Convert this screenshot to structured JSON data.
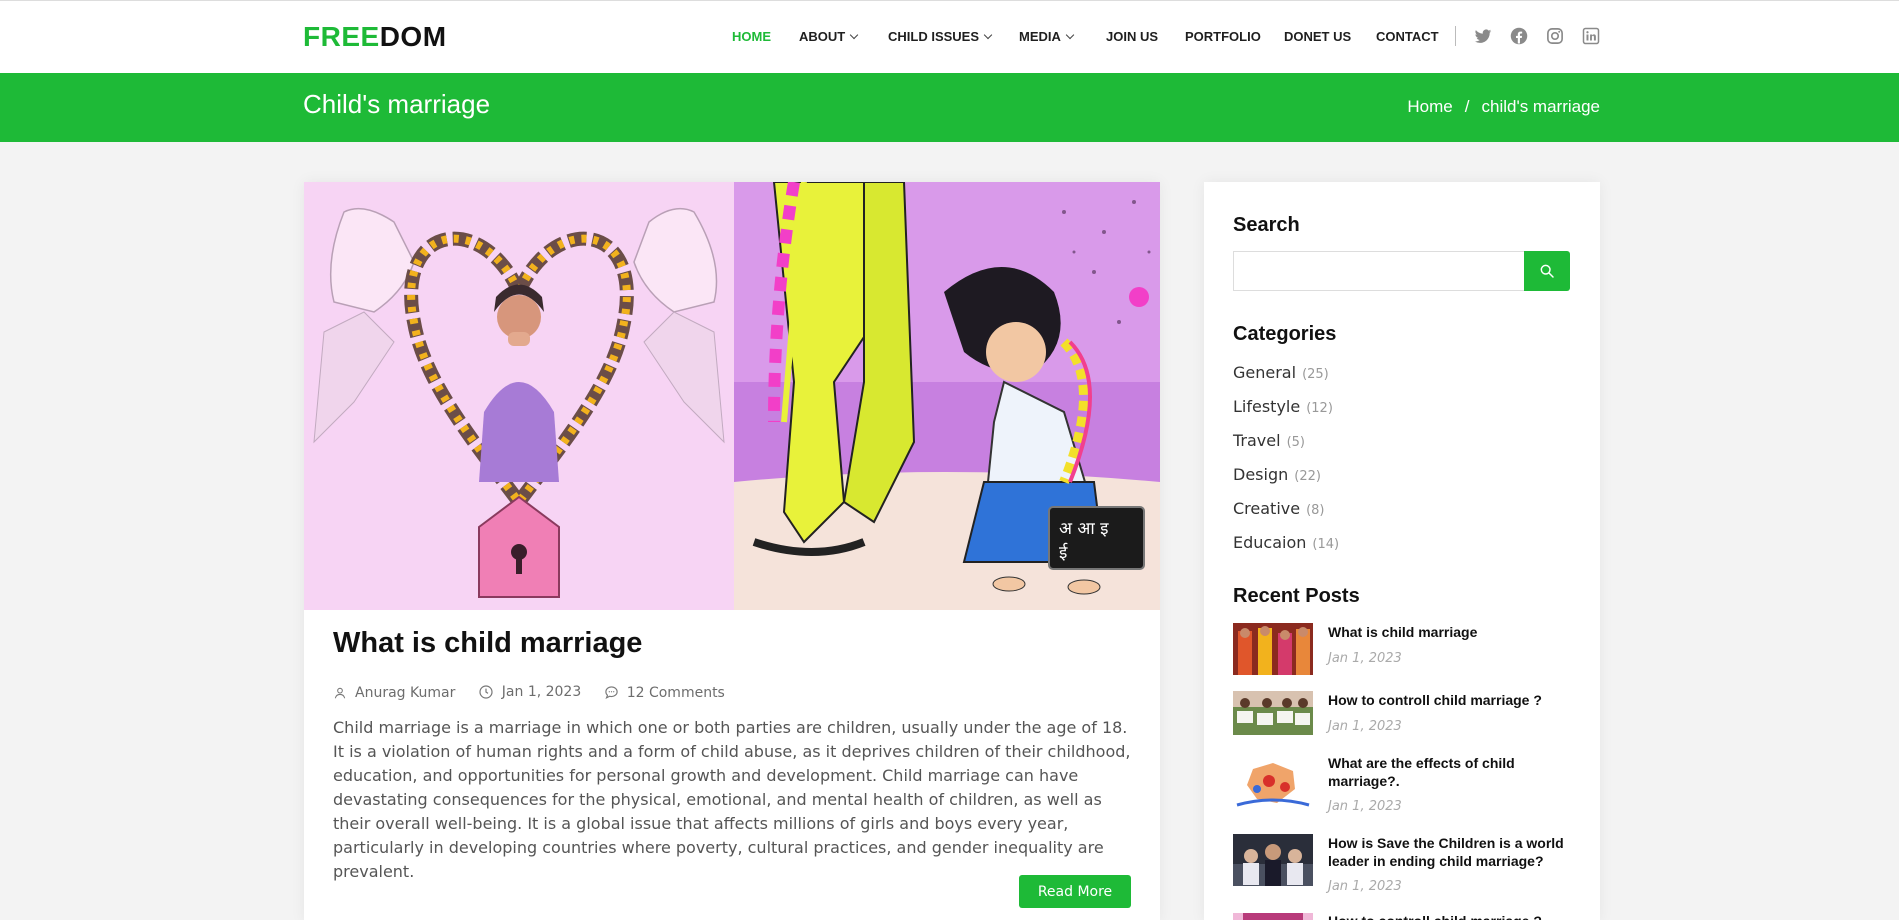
{
  "header": {
    "logo_part1": "FREE",
    "logo_part2": "DOM",
    "nav": [
      "HOME",
      "ABOUT",
      "CHILD ISSUES",
      "MEDIA",
      "JOIN US",
      "PORTFOLIO",
      "DONET US",
      "CONTACT"
    ],
    "social": [
      "twitter-icon",
      "facebook-icon",
      "instagram-icon",
      "linkedin-icon"
    ]
  },
  "band": {
    "title": "Child's marriage",
    "breadcrumb_home": "Home",
    "breadcrumb_sep": "/",
    "breadcrumb_current": "child's marriage"
  },
  "post": {
    "title": "What is child marriage",
    "author": "Anurag Kumar",
    "date": "Jan 1, 2023",
    "comments": "12 Comments",
    "excerpt": "Child marriage is a marriage in which one or both parties are children, usually under the age of 18. It is a violation of human rights and a form of child abuse, as it deprives children of their childhood, education, and opportunities for personal growth and development. Child marriage can have devastating consequences for the physical, emotional, and mental health of children, as well as their overall well-being. It is a global issue that affects millions of girls and boys every year, particularly in developing countries where poverty, cultural practices, and gender inequality are prevalent.",
    "read_more": "Read More",
    "image_sign_text_line1": "अ आ इ",
    "image_sign_text_line2": "ई"
  },
  "sidebar": {
    "search_heading": "Search",
    "search_placeholder": "",
    "categories_heading": "Categories",
    "categories": [
      {
        "name": "General",
        "count": "(25)"
      },
      {
        "name": "Lifestyle",
        "count": "(12)"
      },
      {
        "name": "Travel",
        "count": "(5)"
      },
      {
        "name": "Design",
        "count": "(22)"
      },
      {
        "name": "Creative",
        "count": "(8)"
      },
      {
        "name": "Educaion",
        "count": "(14)"
      }
    ],
    "recent_heading": "Recent Posts",
    "recent_posts": [
      {
        "title": "What is child marriage",
        "date": "Jan 1, 2023"
      },
      {
        "title": "How to controll child marriage ?",
        "date": "Jan 1, 2023"
      },
      {
        "title": "What are the effects of child marriage?.",
        "date": "Jan 1, 2023"
      },
      {
        "title": "How is Save the Children is a world leader in ending child marriage?",
        "date": "Jan 1, 2023"
      },
      {
        "title": "How to controll child marriage ?",
        "date": ""
      }
    ]
  },
  "colors": {
    "accent": "#1eba37",
    "band": "#1eba37",
    "text": "#222222"
  }
}
